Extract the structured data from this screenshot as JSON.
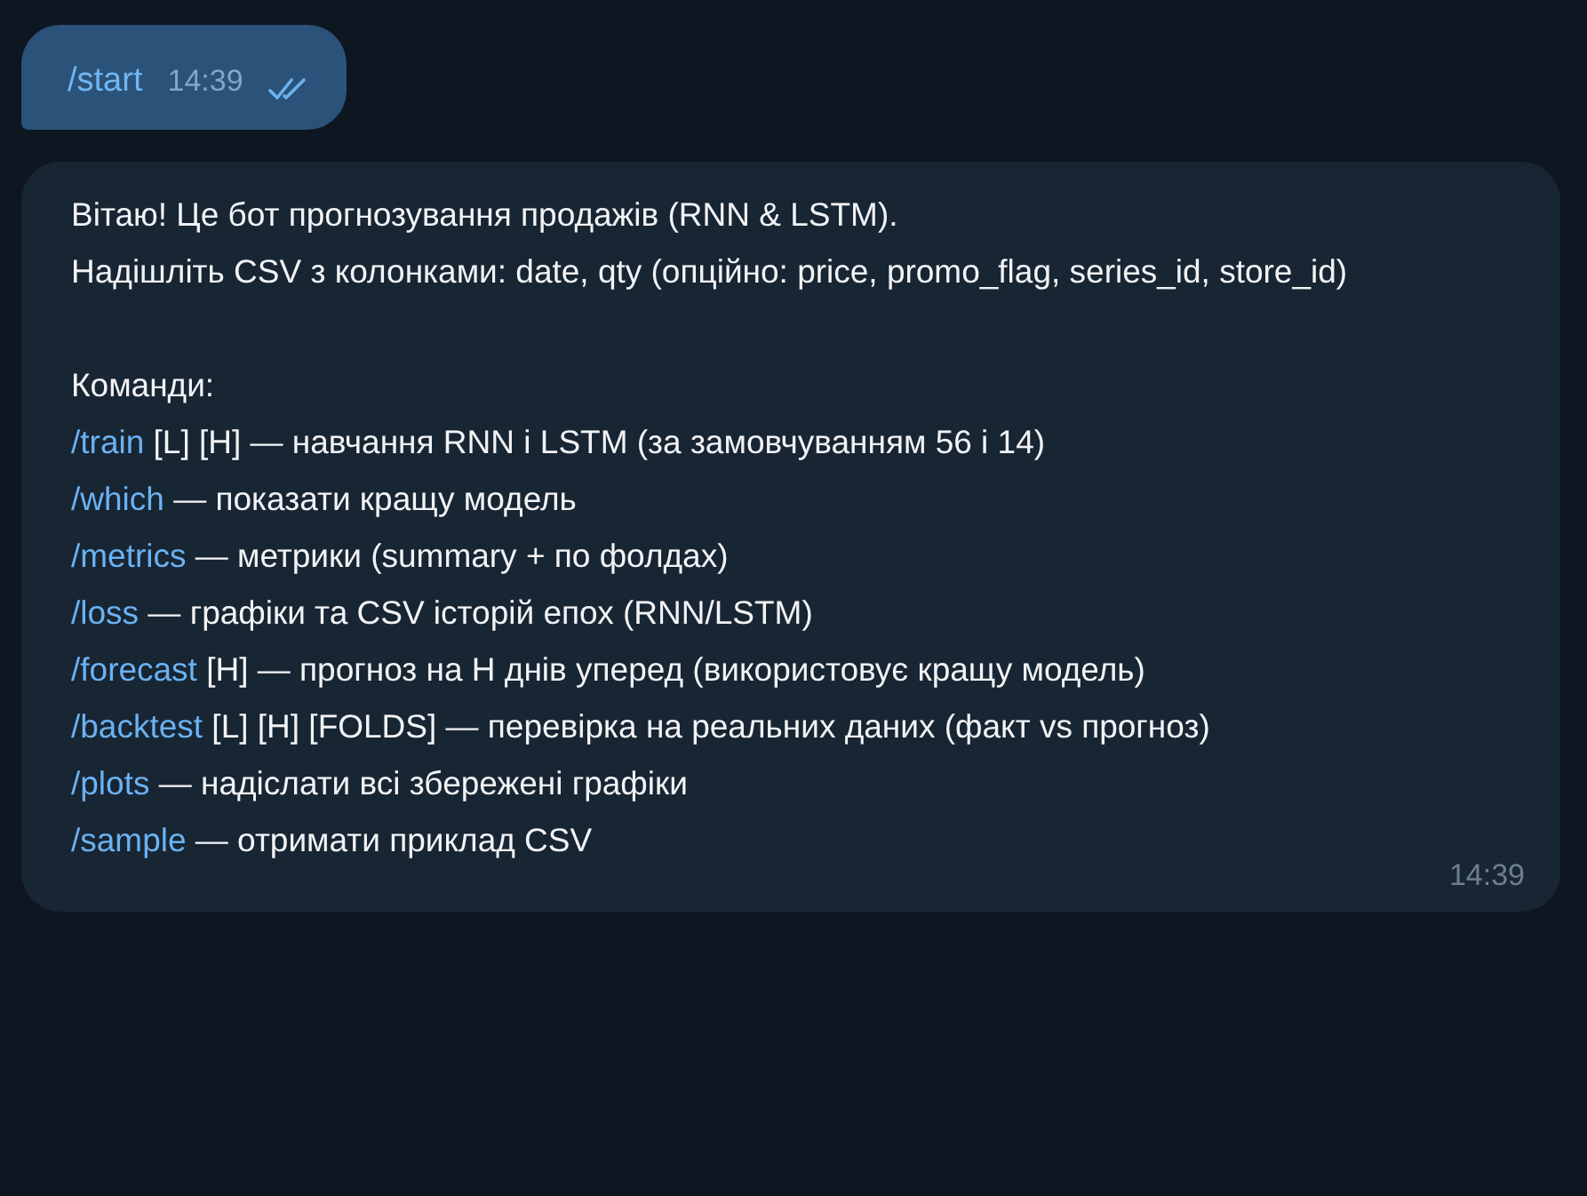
{
  "outgoing": {
    "text": "/start",
    "time": "14:39",
    "read": true
  },
  "incoming": {
    "intro": [
      "Вітаю! Це бот прогнозування продажів (RNN & LSTM).",
      "Надішліть CSV з колонками: date, qty (опційно: price, promo_flag, series_id, store_id)"
    ],
    "commands_heading": "Команди:",
    "commands": [
      {
        "command": "/train",
        "description": "[L] [H] — навчання RNN і LSTM (за замовчуванням 56 і 14)"
      },
      {
        "command": "/which",
        "description": "— показати кращу модель"
      },
      {
        "command": "/metrics",
        "description": "— метрики (summary + по фолдах)"
      },
      {
        "command": "/loss",
        "description": "— графіки та CSV історій епох (RNN/LSTM)"
      },
      {
        "command": "/forecast",
        "description": "[H] — прогноз на H днів уперед (використовує кращу модель)"
      },
      {
        "command": "/backtest",
        "description": "[L] [H] [FOLDS] — перевірка на реальних даних (факт vs прогноз)"
      },
      {
        "command": "/plots",
        "description": "— надіслати всі збережені графіки"
      },
      {
        "command": "/sample",
        "description": "— отримати приклад CSV"
      }
    ],
    "time": "14:39"
  }
}
